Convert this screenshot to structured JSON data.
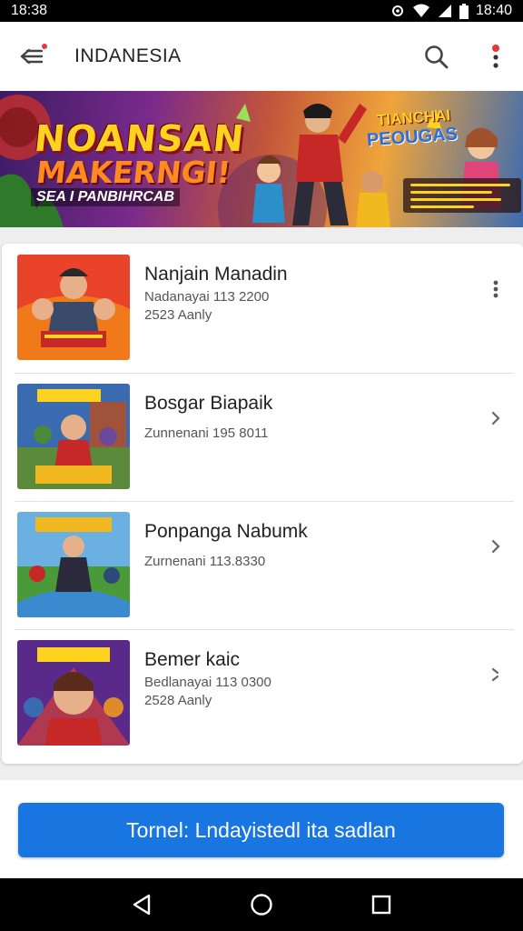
{
  "status_bar": {
    "time_left": "18:38",
    "time_right": "18:40"
  },
  "app_bar": {
    "title": "INDANESIA"
  },
  "banner": {
    "title_line1": "NOANSAN",
    "title_line2": "MAKERNGI!",
    "subtitle": "SEA I PANBIHRCAB",
    "side_title_top": "TIANCHAI",
    "side_title_bottom": "PEOUGAS"
  },
  "list_items": [
    {
      "title": "Nanjain Manadin",
      "line1": "Nadanayai 113 2200",
      "line2": "2523 Aanly",
      "action_icon": "more-vert-icon"
    },
    {
      "title": "Bosgar Biapaik",
      "line1": "Zunnenani 195 8011",
      "line2": "",
      "action_icon": "chevron-right-icon"
    },
    {
      "title": "Ponpanga Nabumk",
      "line1": "Zurnenani 113.8330",
      "line2": "",
      "action_icon": "chevron-right-icon"
    },
    {
      "title": "Bemer kaic",
      "line1": "Bedlanayai 113 0300",
      "line2": "2528 Aanly",
      "action_icon": "chevron-expand-icon"
    }
  ],
  "cta": {
    "label": "Tornel: Lndayistedl ita sadlan"
  },
  "colors": {
    "accent": "#1976e0",
    "badge": "#e53935",
    "status_bar": "#000000"
  }
}
